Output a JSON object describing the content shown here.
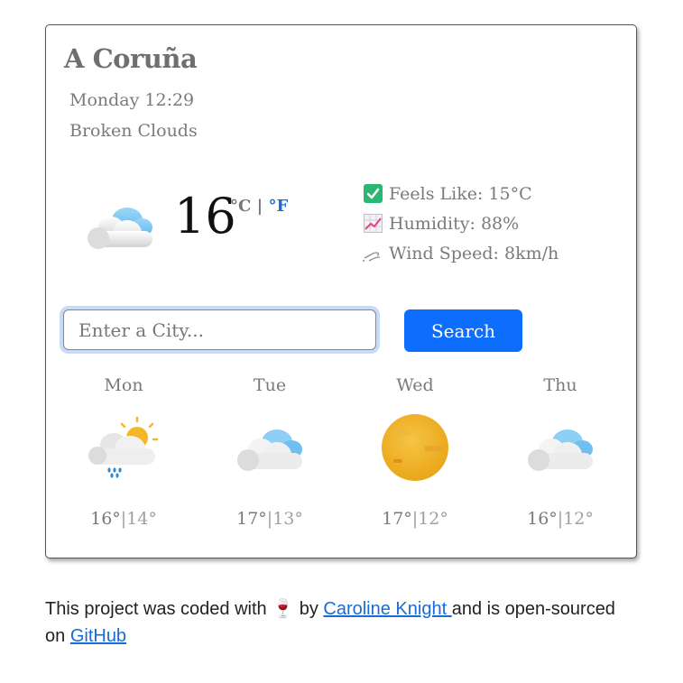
{
  "weather": {
    "city": "A Coruña",
    "day_time": "Monday 12:29",
    "description": "Broken Clouds",
    "temperature": "16",
    "unit_celsius": "°C",
    "unit_separator": "|",
    "unit_fahrenheit": "°F",
    "current_icon": "cloud-icon"
  },
  "details": [
    {
      "label": "Feels Like: 15°C",
      "icon": "check-icon"
    },
    {
      "label": "Humidity: 88%",
      "icon": "chart-icon"
    },
    {
      "label": "Wind Speed: 8km/h",
      "icon": "wind-icon"
    }
  ],
  "search": {
    "placeholder": "Enter a City...",
    "value": "",
    "button_label": "Search"
  },
  "forecast": [
    {
      "day": "Mon",
      "icon": "rain-sun-icon",
      "high": "16°",
      "low": "14°"
    },
    {
      "day": "Tue",
      "icon": "cloud-icon",
      "high": "17°",
      "low": "13°"
    },
    {
      "day": "Wed",
      "icon": "sun-icon",
      "high": "17°",
      "low": "12°"
    },
    {
      "day": "Thu",
      "icon": "cloud-icon",
      "high": "16°",
      "low": "12°"
    }
  ],
  "forecast_separator": "|",
  "footer": {
    "prefix": "This project was coded with",
    "emoji": "🍷",
    "by": "by",
    "author_link": "Caroline Knight ",
    "middle": "and is open-sourced",
    "on": "on",
    "github_link": "GitHub"
  },
  "colors": {
    "accent": "#0d6efd",
    "link": "#1a6bd8",
    "check_green": "#2bb673"
  }
}
